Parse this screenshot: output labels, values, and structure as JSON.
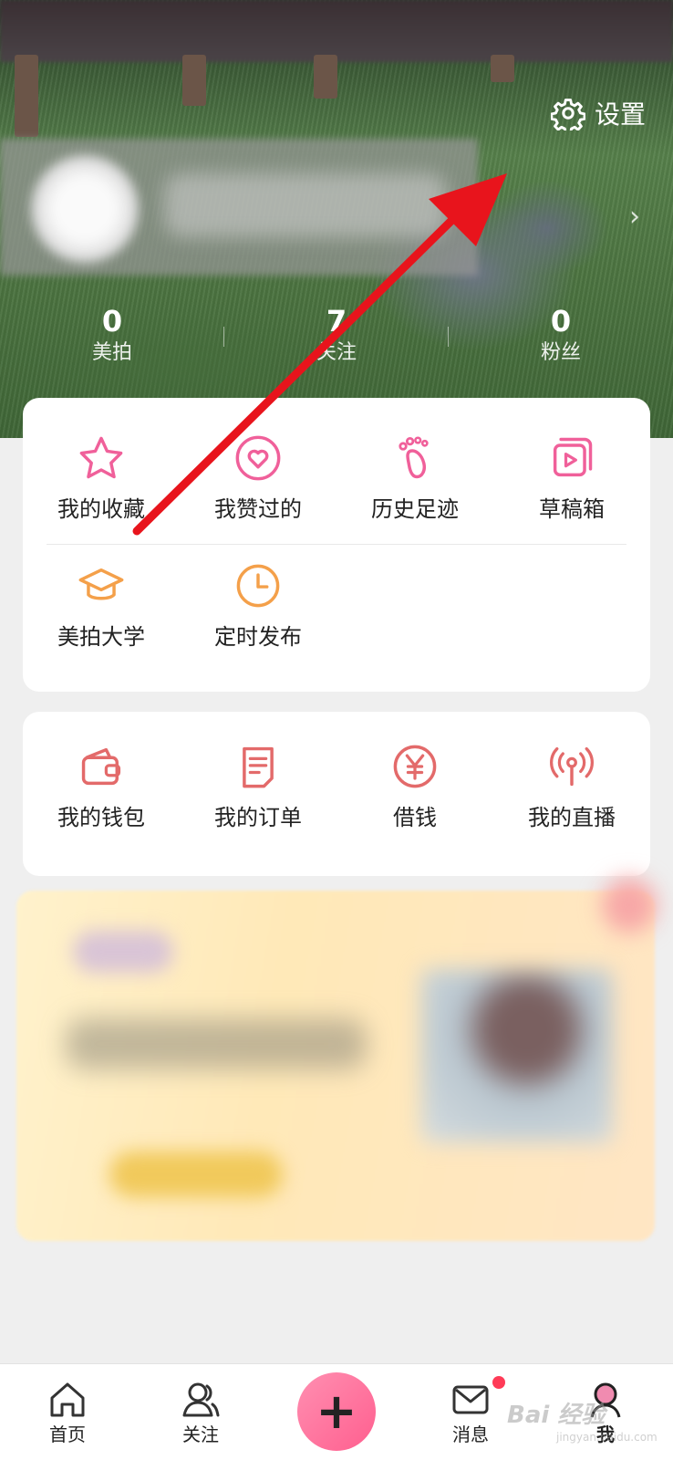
{
  "header": {
    "settings_label": "设置",
    "stats": [
      {
        "value": "0",
        "label": "美拍"
      },
      {
        "value": "7",
        "label": "关注"
      },
      {
        "value": "0",
        "label": "粉丝"
      }
    ]
  },
  "grid1": {
    "row1": [
      {
        "label": "我的收藏",
        "icon": "star-icon"
      },
      {
        "label": "我赞过的",
        "icon": "heart-circle-icon"
      },
      {
        "label": "历史足迹",
        "icon": "footprint-icon"
      },
      {
        "label": "草稿箱",
        "icon": "video-drafts-icon"
      }
    ],
    "row2": [
      {
        "label": "美拍大学",
        "icon": "graduation-cap-icon"
      },
      {
        "label": "定时发布",
        "icon": "clock-icon"
      }
    ]
  },
  "grid2": [
    {
      "label": "我的钱包",
      "icon": "wallet-icon"
    },
    {
      "label": "我的订单",
      "icon": "order-icon"
    },
    {
      "label": "借钱",
      "icon": "yen-icon"
    },
    {
      "label": "我的直播",
      "icon": "live-broadcast-icon"
    }
  ],
  "tabbar": {
    "home": "首页",
    "follow": "关注",
    "messages": "消息",
    "me": "我"
  },
  "watermark": {
    "text": "Bai 经验",
    "sub": "jingyan.baidu.com"
  },
  "colors": {
    "pink": "#f0609a",
    "orange": "#f4a04a",
    "red": "#e36a6a",
    "arrow": "#e8141c"
  }
}
